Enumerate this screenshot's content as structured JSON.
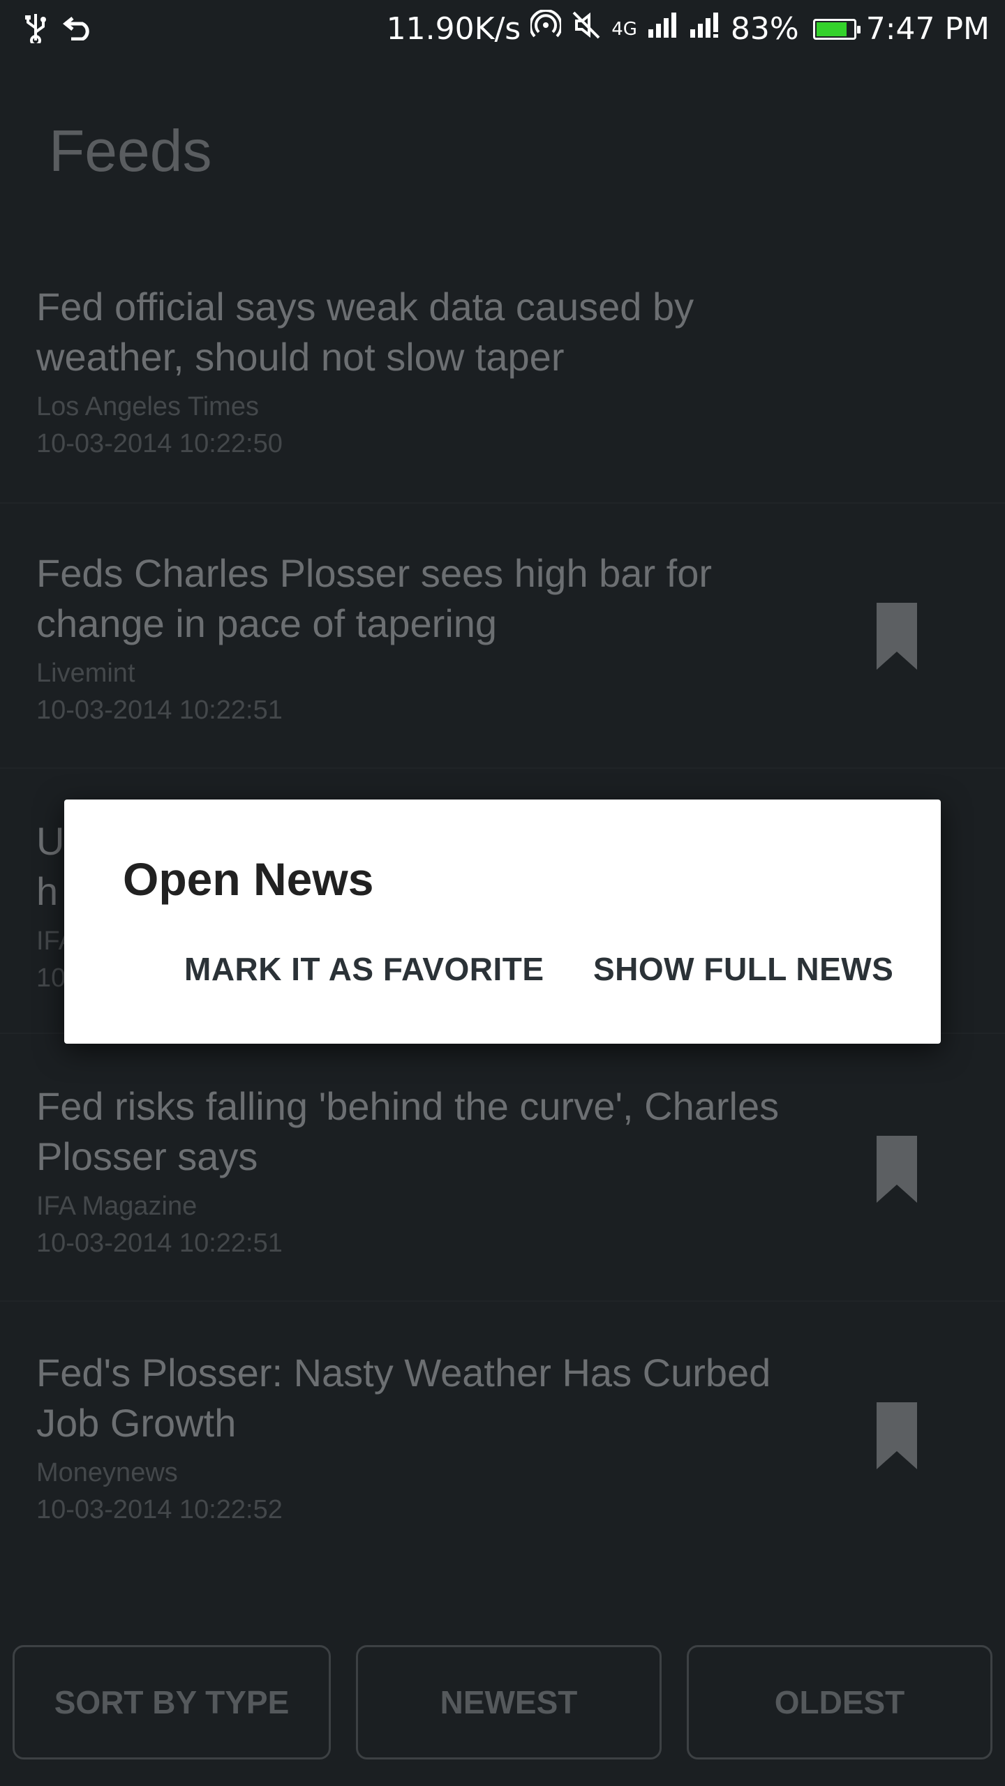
{
  "status_bar": {
    "usb_icon": "usb-icon",
    "back_icon": "undo-arrow-icon",
    "net_speed": "11.90K/s",
    "network_type": "4G",
    "battery_percent": "83%",
    "battery_level": 0.83,
    "time": "7:47 PM"
  },
  "header": {
    "title": "Feeds"
  },
  "feeds": [
    {
      "title": "Fed official says weak data caused by weather, should not slow taper",
      "source": "Los Angeles Times",
      "date": "10-03-2014 10:22:50",
      "bookmarked": false
    },
    {
      "title": "Feds Charles Plosser sees high bar for change in pace of tapering",
      "source": "Livemint",
      "date": "10-03-2014 10:22:51",
      "bookmarked": true
    },
    {
      "title": "U",
      "title_line2": "h",
      "source": "IFA",
      "date": "10",
      "bookmarked": false
    },
    {
      "title": "Fed risks falling 'behind the curve', Charles Plosser says",
      "source": "IFA Magazine",
      "date": "10-03-2014 10:22:51",
      "bookmarked": true
    },
    {
      "title": "Fed's Plosser: Nasty Weather Has Curbed Job Growth",
      "source": "Moneynews",
      "date": "10-03-2014 10:22:52",
      "bookmarked": true
    }
  ],
  "dialog": {
    "title": "Open News",
    "mark_favorite_label": "MARK IT AS FAVORITE",
    "show_full_label": "SHOW FULL NEWS"
  },
  "bottom_bar": {
    "sort_by_type_label": "SORT BY TYPE",
    "newest_label": "NEWEST",
    "oldest_label": "OLDEST"
  },
  "colors": {
    "background": "#1b1f22",
    "dialog_bg": "#ffffff",
    "battery_fill": "#34d22b"
  }
}
